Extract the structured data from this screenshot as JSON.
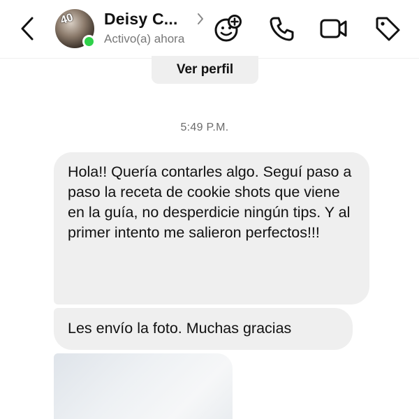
{
  "header": {
    "back_icon": "chevron-left-icon",
    "avatar_badge": "40",
    "name": "Deisy C...",
    "status": "Activo(a) ahora",
    "online_color": "#2fd14a",
    "actions": [
      "add-emoji-icon",
      "phone-icon",
      "video-camera-icon",
      "tag-icon"
    ]
  },
  "profile_button": {
    "label": "Ver perfil"
  },
  "chat": {
    "timestamp": "5:49 P.M.",
    "messages": [
      {
        "text": "Hola!! Quería contarles algo. Seguí paso a paso la receta de cookie shots que viene en la guía, no desperdicie ningún tips. Y al primer intento me salieron perfectos!!!"
      },
      {
        "text": "Les envío la foto. Muchas gracias"
      }
    ]
  },
  "colors": {
    "bubble": "#efefef",
    "muted_text": "#777777"
  }
}
